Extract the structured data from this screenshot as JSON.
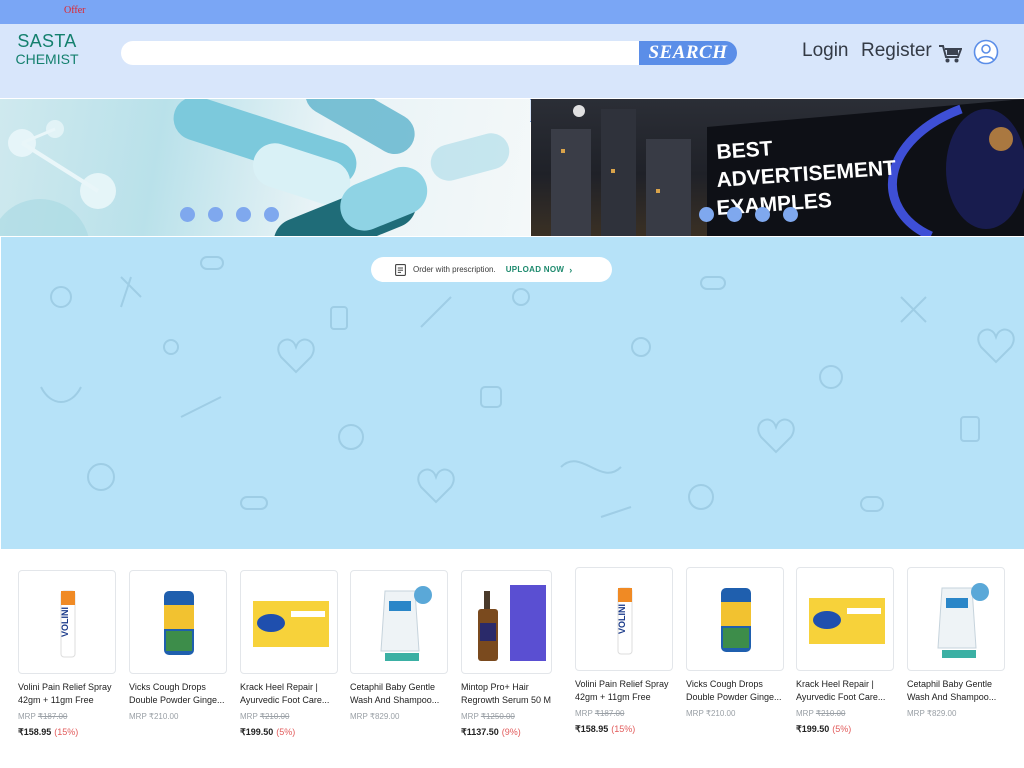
{
  "topbar": {
    "offer": "Offer"
  },
  "header": {
    "logo_line1": "SASTA",
    "logo_line2": "CHEMIST",
    "search_placeholder": "",
    "search_button": "SEARCH",
    "login": "Login",
    "register": "Register",
    "cart_icon": "cart-icon",
    "user_icon": "user-icon"
  },
  "banners": {
    "left": {
      "dots": 4
    },
    "right": {
      "billboard_line1": "BEST",
      "billboard_line2": "ADVERTISEMENT",
      "billboard_line3": "EXAMPLES",
      "dots": 4
    }
  },
  "prescription": {
    "text": "Order with prescription.",
    "cta": "UPLOAD NOW",
    "chevron": "›"
  },
  "products_left": [
    {
      "name": "Volini Pain Relief Spray\n42gm + 11gm Free",
      "mrp_label": "MRP",
      "mrp": "₹187.00",
      "price": "₹158.95",
      "discount": "(15%)"
    },
    {
      "name": "Vicks Cough Drops\nDouble Powder Ginge...",
      "mrp_label": "MRP",
      "mrp": "₹210.00",
      "price": "",
      "discount": ""
    },
    {
      "name": "Krack Heel Repair |\nAyurvedic Foot Care...",
      "mrp_label": "MRP",
      "mrp": "₹210.00",
      "price": "₹199.50",
      "discount": "(5%)"
    },
    {
      "name": "Cetaphil Baby Gentle\nWash And Shampoo...",
      "mrp_label": "MRP",
      "mrp": "₹829.00",
      "price": "",
      "discount": ""
    },
    {
      "name": "Mintop Pro+ Hair\nRegrowth Serum 50 M",
      "mrp_label": "MRP",
      "mrp": "₹1250.00",
      "price": "₹1137.50",
      "discount": "(9%)"
    }
  ],
  "products_right": [
    {
      "name": "Volini Pain Relief Spray\n42gm + 11gm Free",
      "mrp_label": "MRP",
      "mrp": "₹187.00",
      "price": "₹158.95",
      "discount": "(15%)"
    },
    {
      "name": "Vicks Cough Drops\nDouble Powder Ginge...",
      "mrp_label": "MRP",
      "mrp": "₹210.00",
      "price": "",
      "discount": ""
    },
    {
      "name": "Krack Heel Repair |\nAyurvedic Foot Care...",
      "mrp_label": "MRP",
      "mrp": "₹210.00",
      "price": "₹199.50",
      "discount": "(5%)"
    },
    {
      "name": "Cetaphil Baby Gentle\nWash And Shampoo...",
      "mrp_label": "MRP",
      "mrp": "₹829.00",
      "price": "",
      "discount": ""
    }
  ],
  "colors": {
    "topbar": "#7aa6f5",
    "header": "#d8e6fb",
    "logo": "#14806e",
    "search_button": "#5b8ee8",
    "prescription_panel": "#b6e2f8",
    "discount": "#e25b5b"
  }
}
